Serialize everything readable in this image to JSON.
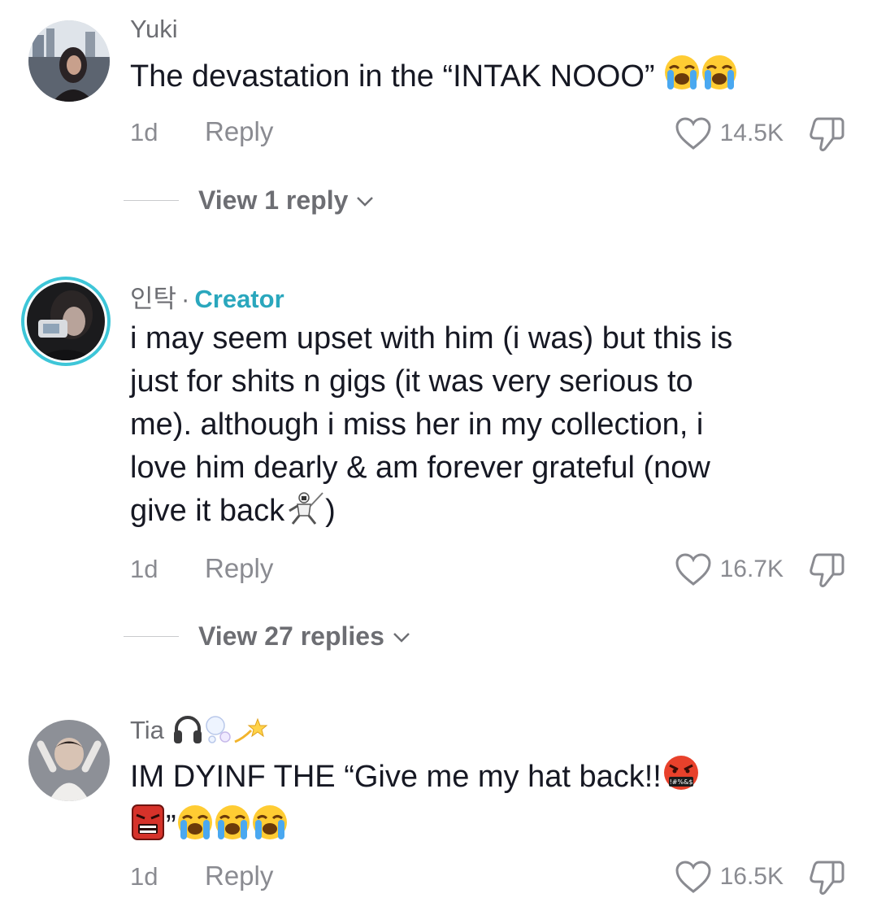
{
  "comments": [
    {
      "username": "Yuki",
      "text_before": "The devastation in the “INTAK NOOO” ",
      "emojis": [
        "crying-face",
        "crying-face"
      ],
      "time": "1d",
      "reply_label": "Reply",
      "likes": "14.5K",
      "view_replies": "View 1 reply"
    },
    {
      "username": "인탁",
      "separator": "·",
      "creator_tag": "Creator",
      "text_lines": [
        "i may seem upset with him (i was) but this is",
        "just for shits n gigs (it was very serious to",
        "me). although i miss her in my collection, i",
        "love him dearly & am forever grateful (now",
        "give it back"
      ],
      "text_after_emoji": ")",
      "inline_emoji": "fencer",
      "time": "1d",
      "reply_label": "Reply",
      "likes": "16.7K",
      "view_replies": "View 27 replies"
    },
    {
      "username": "Tia",
      "username_emojis": [
        "headphone",
        "bubbles",
        "dizzy"
      ],
      "text_line1": "IM DYINF THE “Give me my hat back!!",
      "text_line2_prefix": "”",
      "emojis_line1": [
        "cursing-face"
      ],
      "emojis_line2": [
        "anger-character",
        "crying-face",
        "crying-face",
        "crying-face"
      ],
      "time": "1d",
      "reply_label": "Reply",
      "likes": "16.5K"
    }
  ],
  "icons": {
    "heart": "heart-outline-icon",
    "dislike": "thumbs-down-icon",
    "chevron": "chevron-down-icon"
  },
  "colors": {
    "creator_accent": "#2aa7bd",
    "muted": "#8a8b91",
    "text": "#161823"
  }
}
